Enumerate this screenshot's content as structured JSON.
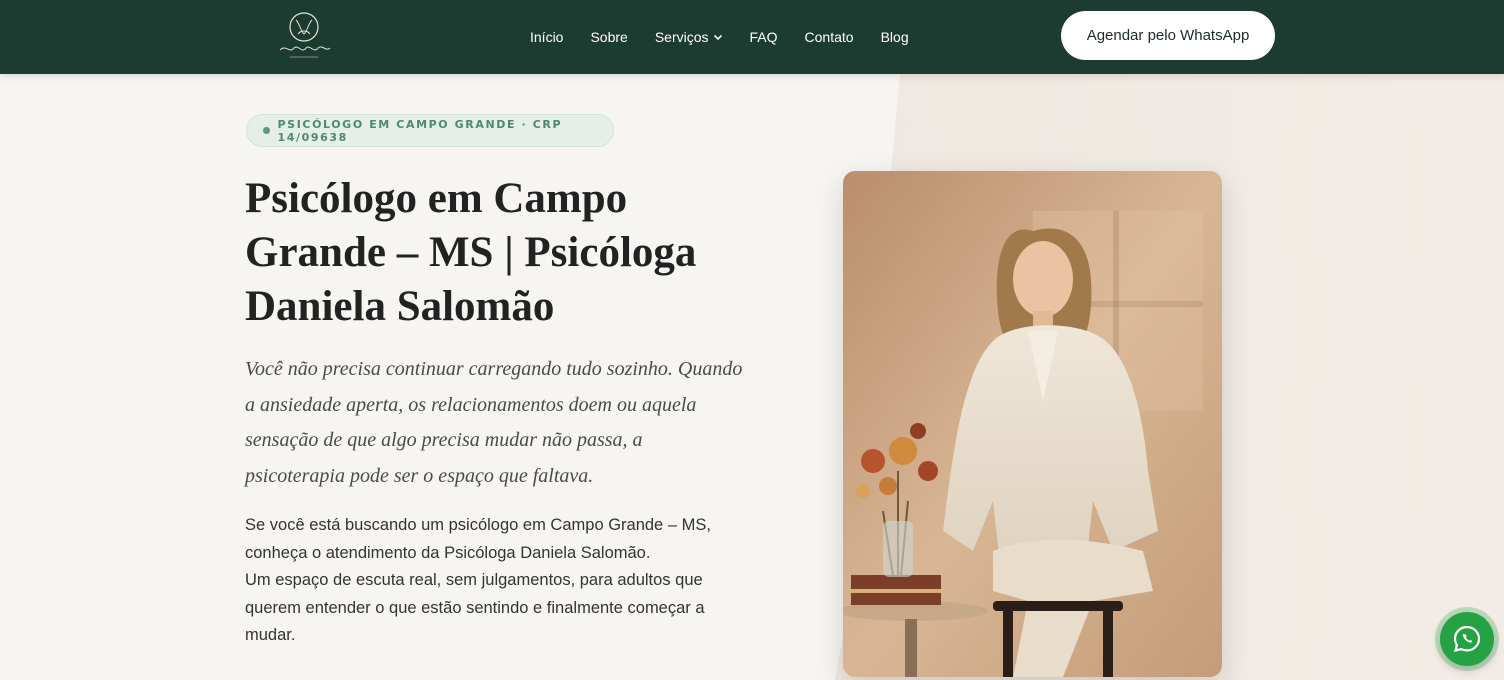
{
  "header": {
    "logo_alt": "Daniela Salomão",
    "nav": [
      {
        "label": "Início"
      },
      {
        "label": "Sobre"
      },
      {
        "label": "Serviços",
        "has_dropdown": true
      },
      {
        "label": "FAQ"
      },
      {
        "label": "Contato"
      },
      {
        "label": "Blog"
      }
    ],
    "cta_label": "Agendar pelo WhatsApp"
  },
  "hero": {
    "badge": "PSICÓLOGO EM CAMPO GRANDE · CRP 14/09638",
    "title_lines": [
      "Psicólogo em Campo",
      "Grande – MS | Psicóloga",
      "Daniela Salomão"
    ],
    "lead": "Você não precisa continuar carregando tudo sozinho. Quando a ansiedade aperta, os relacionamentos doem ou aquela sensação de que algo precisa mudar não passa, a psicoterapia pode ser o espaço que faltava.",
    "body_lines": [
      "Se você está buscando um psicólogo em Campo Grande – MS,",
      "conheça o atendimento da Psicóloga Daniela Salomão.",
      "Um espaço de escuta real, sem julgamentos, para adultos que",
      "querem entender o que estão sentindo e finalmente começar a",
      "mudar."
    ]
  },
  "colors": {
    "header_bg": "#1c3b31",
    "page_bg": "#f7f5f1",
    "accent_green": "#4a8a70",
    "whatsapp_green": "#25a244"
  },
  "icons": {
    "floating": "whatsapp-icon",
    "nav_dropdown": "chevron-down-icon"
  }
}
